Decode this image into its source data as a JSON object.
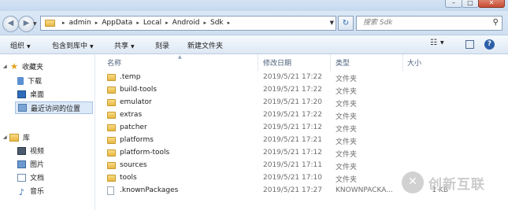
{
  "address_bar": {
    "breadcrumbs": [
      "admin",
      "AppData",
      "Local",
      "Android",
      "Sdk"
    ],
    "search_placeholder": "搜索 Sdk"
  },
  "caption_buttons": {
    "minimize": "–",
    "maximize": "□",
    "close": "✕"
  },
  "toolbar": {
    "organize": "组织",
    "include_in_library": "包含到库中",
    "share": "共享",
    "burn": "刻录",
    "new_folder": "新建文件夹"
  },
  "nav_pane": {
    "favorites": "收藏夹",
    "favorites_items": [
      "下载",
      "桌面",
      "最近访问的位置"
    ],
    "libraries": "库",
    "library_items": [
      "视频",
      "图片",
      "文档",
      "音乐"
    ]
  },
  "columns": {
    "name": "名称",
    "date": "修改日期",
    "type": "类型",
    "size": "大小"
  },
  "files": [
    {
      "name": ".temp",
      "date": "2019/5/21 17:22",
      "type": "文件夹",
      "size": "",
      "kind": "folder"
    },
    {
      "name": "build-tools",
      "date": "2019/5/21 17:22",
      "type": "文件夹",
      "size": "",
      "kind": "folder"
    },
    {
      "name": "emulator",
      "date": "2019/5/21 17:20",
      "type": "文件夹",
      "size": "",
      "kind": "folder"
    },
    {
      "name": "extras",
      "date": "2019/5/21 17:22",
      "type": "文件夹",
      "size": "",
      "kind": "folder"
    },
    {
      "name": "patcher",
      "date": "2019/5/21 17:12",
      "type": "文件夹",
      "size": "",
      "kind": "folder"
    },
    {
      "name": "platforms",
      "date": "2019/5/21 17:21",
      "type": "文件夹",
      "size": "",
      "kind": "folder"
    },
    {
      "name": "platform-tools",
      "date": "2019/5/21 17:12",
      "type": "文件夹",
      "size": "",
      "kind": "folder"
    },
    {
      "name": "sources",
      "date": "2019/5/21 17:11",
      "type": "文件夹",
      "size": "",
      "kind": "folder"
    },
    {
      "name": "tools",
      "date": "2019/5/21 17:10",
      "type": "文件夹",
      "size": "",
      "kind": "folder"
    },
    {
      "name": ".knownPackages",
      "date": "2019/5/21 17:27",
      "type": "KNOWNPACKA...",
      "size": "1 KB",
      "kind": "file"
    }
  ],
  "watermark": {
    "text": "创新互联"
  },
  "colors": {
    "accent": "#2b5fa8",
    "folder": "#e7b843",
    "selection": "#dce9f8"
  }
}
